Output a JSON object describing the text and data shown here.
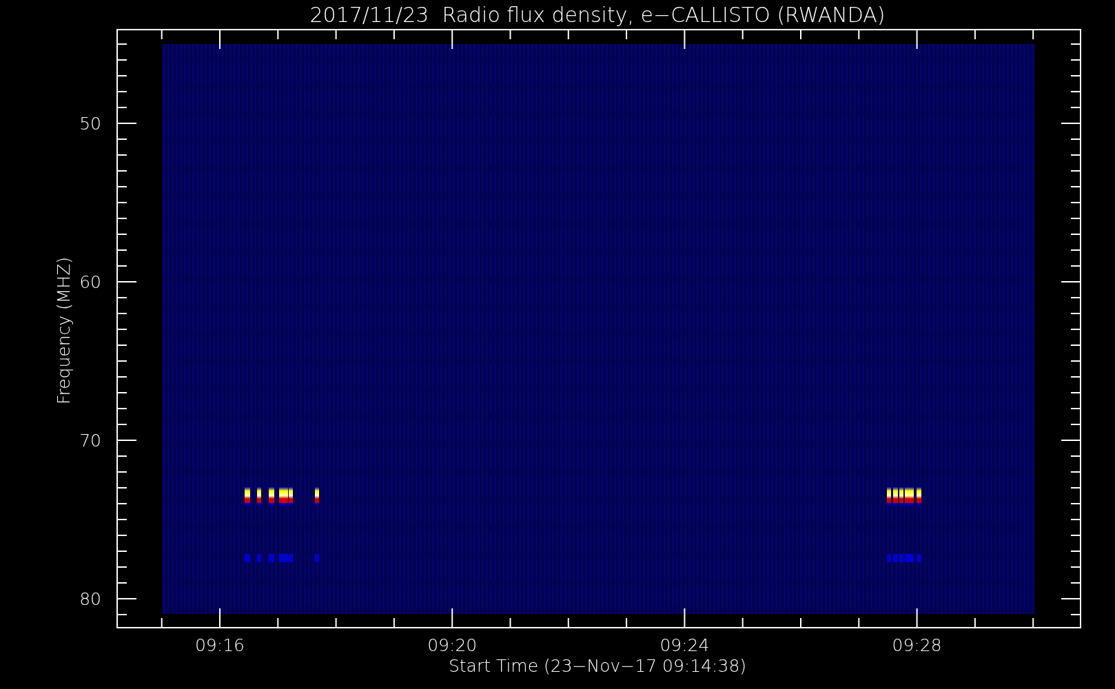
{
  "title": "2017/11/23  Radio flux density, e−CALLISTO (RWANDA)",
  "plot": {
    "kind": "spectrogram",
    "yticks": [
      "50",
      "60",
      "70",
      "80"
    ],
    "xticks": [
      "09:16",
      "09:20",
      "09:24",
      "09:28"
    ],
    "ylabel": "Frequency (MHZ)",
    "xlabel": "Start Time (23−Nov−17 09:14:38)"
  }
}
